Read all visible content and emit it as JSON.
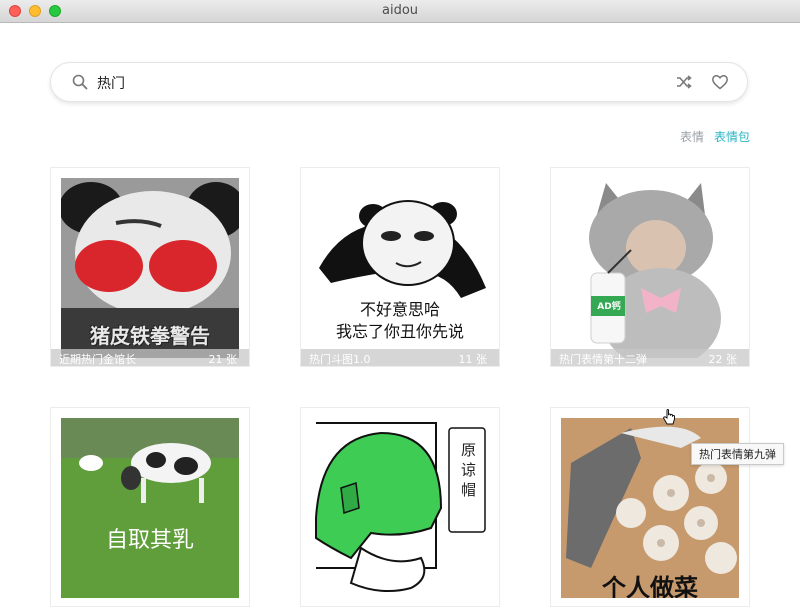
{
  "window": {
    "title": "aidou"
  },
  "search": {
    "value": "热门",
    "placeholder": ""
  },
  "tabs": [
    {
      "label": "表情",
      "active": false
    },
    {
      "label": "表情包",
      "active": true
    }
  ],
  "colors": {
    "accent": "#2bb5c4",
    "inactive_tab": "#9aa0a6"
  },
  "packs": [
    {
      "name": "近期热门金馆长",
      "count": "21 张",
      "image_text": [
        "猪皮铁拳警告"
      ]
    },
    {
      "name": "热门斗图1.0",
      "count": "11 张",
      "image_text": [
        "不好意思哈",
        "我忘了你丑你先说"
      ]
    },
    {
      "name": "热门表情第十二弹",
      "count": "22 张",
      "image_text": [
        "AD钙"
      ]
    },
    {
      "name": "",
      "count": "",
      "image_text": [
        "自取其乳"
      ]
    },
    {
      "name": "",
      "count": "",
      "image_text": [
        "原谅帽"
      ]
    },
    {
      "name": "",
      "count": "",
      "image_text": [
        "个人做菜"
      ]
    }
  ],
  "tooltip": {
    "text": "热门表情第九弹"
  }
}
